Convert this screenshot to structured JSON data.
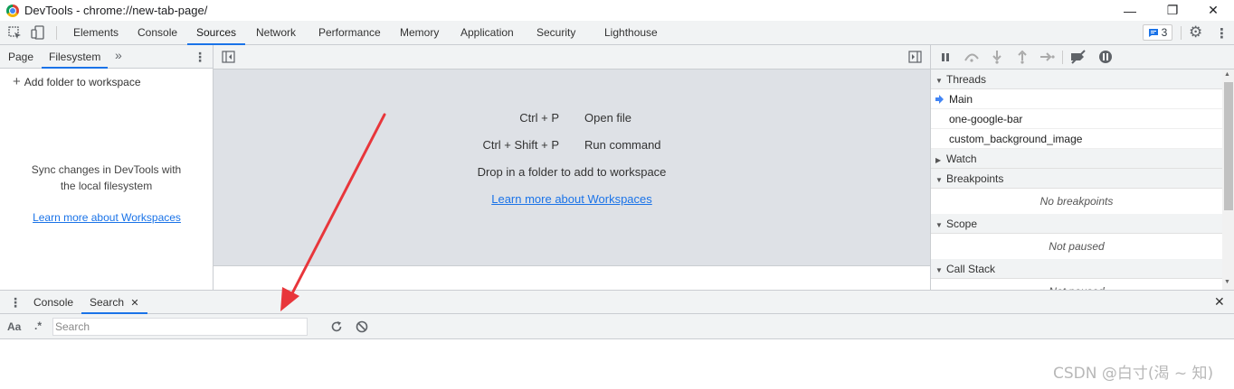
{
  "window": {
    "title": "DevTools - chrome://new-tab-page/",
    "minimize": "—",
    "restore": "❐",
    "close": "✕"
  },
  "toolbar": {
    "inspect_icon": "⬚",
    "device_icon": "▯",
    "tabs": [
      "Elements",
      "Console",
      "Sources",
      "Network",
      "Performance",
      "Memory",
      "Application",
      "Security",
      "Lighthouse"
    ],
    "active_tab": "Sources",
    "issues_count": "3",
    "settings_icon": "⚙",
    "more_icon": "⋮",
    "close_icon": "✕"
  },
  "navigator": {
    "tabs": [
      "Page",
      "Filesystem"
    ],
    "active_tab": "Filesystem",
    "more_tabs_icon": "»",
    "menu_icon": "⋮",
    "add_folder_label": "Add folder to workspace",
    "sync_text_line1": "Sync changes in DevTools with",
    "sync_text_line2": "the local filesystem",
    "learn_more": "Learn more about Workspaces"
  },
  "editor": {
    "shortcuts": [
      {
        "key": "Ctrl + P",
        "label": "Open file"
      },
      {
        "key": "Ctrl + Shift + P",
        "label": "Run command"
      }
    ],
    "drop_text": "Drop in a folder to add to workspace",
    "learn_more": "Learn more about Workspaces"
  },
  "debugger": {
    "threads_header": "Threads",
    "threads": [
      "Main",
      "one-google-bar",
      "custom_background_image"
    ],
    "watch_header": "Watch",
    "breakpoints_header": "Breakpoints",
    "breakpoints_msg": "No breakpoints",
    "scope_header": "Scope",
    "scope_msg": "Not paused",
    "callstack_header": "Call Stack",
    "callstack_msg": "Not paused"
  },
  "drawer": {
    "menu_icon": "⋮",
    "tabs": [
      "Console",
      "Search"
    ],
    "active_tab": "Search",
    "close_tab_icon": "✕",
    "close_drawer_icon": "✕",
    "match_case_label": "Aa",
    "regex_label": ".*",
    "search_placeholder": "Search",
    "search_value": "",
    "refresh_icon": "↻",
    "clear_icon": "⃠"
  },
  "watermark": "CSDN @白寸(渴 ~ 知)",
  "colors": {
    "accent": "#1a73e8",
    "annotation_arrow": "#e8363b",
    "toolbar_bg": "#f1f3f4",
    "editor_bg": "#dee1e6"
  }
}
